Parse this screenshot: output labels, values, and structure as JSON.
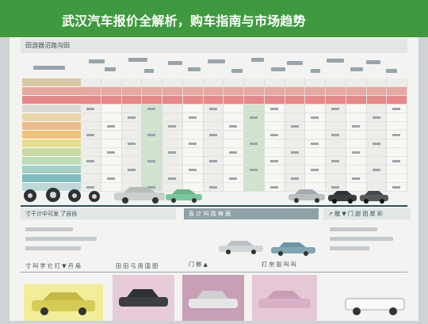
{
  "banner": {
    "title": "武汉汽车报价全解析，购车指南与市场趋势",
    "bg_color": "#3f9a3f"
  },
  "sheet": {
    "title": "田游器沼路沟田",
    "panels": {
      "middle_left": "寸干计中可发 了自自",
      "middle_center": "直 计 叫 围 梅 圈",
      "middle_right": "↗ 醒 ▼ 门 甜 团 聚 彩",
      "bottom_1": "寸 叫 学 它 打 ▼ 丹 局",
      "bottom_2": "田 田 弓 用 国 图",
      "bottom_3": "门 鲫 ▲",
      "bottom_4": "打 帘 驱 叫 叫"
    },
    "row_colors": [
      "#d8c7a5",
      "#e8a7a0",
      "#e7898a",
      "#d9dbd4",
      "#e8d6ab",
      "#eabc8c",
      "#f0c27e",
      "#e7dd91",
      "#c9d9a3",
      "#bfdcb9",
      "#a6cfc7",
      "#7fbcc0",
      "#bfd7d6"
    ]
  },
  "colors": {
    "accent_green": "#3f9a3f",
    "divider": "#2e4f5c",
    "header_bar": "#8fa1a6"
  }
}
